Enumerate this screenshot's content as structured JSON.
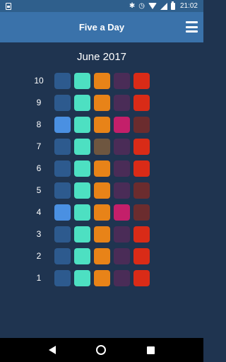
{
  "status_bar": {
    "time": "21:02",
    "icons": [
      "notification-icon",
      "bluetooth-icon",
      "alarm-icon",
      "wifi-icon",
      "signal-icon",
      "battery-icon"
    ]
  },
  "app_bar": {
    "title": "Five a Day",
    "menu_icon": "hamburger-menu-icon"
  },
  "main": {
    "month": "June 2017",
    "rows": [
      {
        "label": "10",
        "cells": [
          "#2d5a8e",
          "#4de0c2",
          "#e88318",
          "#4a2c57",
          "#d92b17"
        ]
      },
      {
        "label": "9",
        "cells": [
          "#2d5a8e",
          "#4de0c2",
          "#e88318",
          "#4a2c57",
          "#d92b17"
        ]
      },
      {
        "label": "8",
        "cells": [
          "#4a90e2",
          "#4de0c2",
          "#e88318",
          "#c41f6a",
          "#6b2c2e"
        ]
      },
      {
        "label": "7",
        "cells": [
          "#2d5a8e",
          "#4de0c2",
          "#6e5640",
          "#4a2c57",
          "#d92b17"
        ]
      },
      {
        "label": "6",
        "cells": [
          "#2d5a8e",
          "#4de0c2",
          "#e88318",
          "#4a2c57",
          "#d92b17"
        ]
      },
      {
        "label": "5",
        "cells": [
          "#2d5a8e",
          "#4de0c2",
          "#e88318",
          "#4a2c57",
          "#6b2c2e"
        ]
      },
      {
        "label": "4",
        "cells": [
          "#4a90e2",
          "#4de0c2",
          "#e88318",
          "#c41f6a",
          "#6b2c2e"
        ]
      },
      {
        "label": "3",
        "cells": [
          "#2d5a8e",
          "#4de0c2",
          "#e88318",
          "#4a2c57",
          "#d92b17"
        ]
      },
      {
        "label": "2",
        "cells": [
          "#2d5a8e",
          "#4de0c2",
          "#e88318",
          "#4a2c57",
          "#d92b17"
        ]
      },
      {
        "label": "1",
        "cells": [
          "#2d5a8e",
          "#4de0c2",
          "#e88318",
          "#4a2c57",
          "#d92b17"
        ]
      }
    ]
  },
  "nav_bar": {
    "icons": [
      "back-icon",
      "home-icon",
      "recents-icon"
    ]
  },
  "colors": {
    "background": "#1f3450",
    "app_bar": "#3a72aa",
    "status_bar": "#2f5f8c"
  }
}
